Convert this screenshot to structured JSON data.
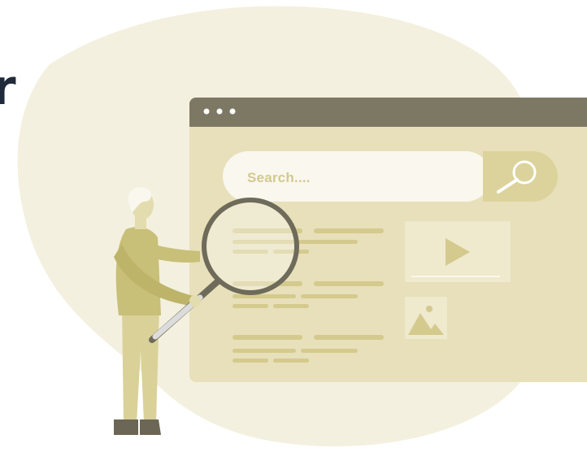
{
  "heading_fragment": "r",
  "search": {
    "placeholder": "Search...."
  },
  "icons": [
    "search-icon",
    "play-icon",
    "image-icon"
  ],
  "colors": {
    "blob": "#f4f0df",
    "window_titlebar": "#7c7863",
    "window_body": "#e7e0ba",
    "search_field": "#f9f7ee",
    "search_button": "#dcd39c",
    "text_line": "#d4ca8d",
    "person_top": "#c8bf78",
    "person_pants": "#d9d198",
    "heading": "#1f2b3a"
  }
}
